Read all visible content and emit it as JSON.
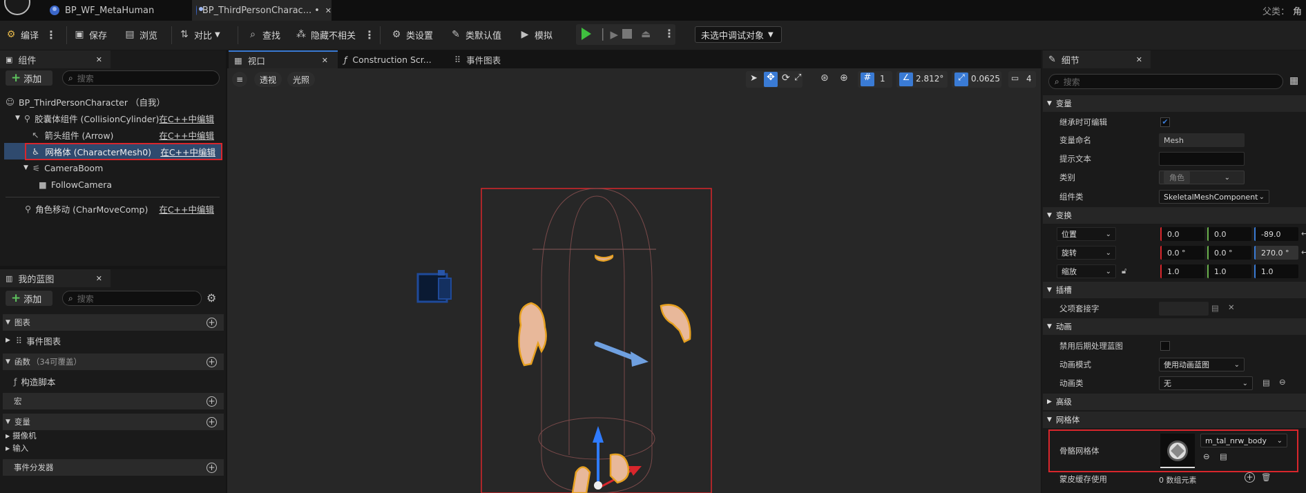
{
  "titlebar": {
    "tabs": [
      {
        "label": "BP_WF_MetaHuman"
      },
      {
        "label": "BP_ThirdPersonCharac...",
        "modified": "•",
        "close": "✕"
      }
    ],
    "parent_label": "父类：",
    "parent_value": "角"
  },
  "toolbar": {
    "compile": "编译",
    "save": "保存",
    "browse": "浏览",
    "diff": "对比",
    "find": "查找",
    "hide_unrelated": "隐藏不相关",
    "class_settings": "类设置",
    "class_defaults": "类默认值",
    "simulate": "模拟",
    "debug_target": "未选中调试对象"
  },
  "components": {
    "title": "组件",
    "close": "✕",
    "add": "添加",
    "search_placeholder": "搜索",
    "root": "BP_ThirdPersonCharacter （自我）",
    "edit_in_cpp": "在C++中编辑",
    "items": [
      {
        "label": "胶囊体组件 (CollisionCylinder)",
        "cpp": "在C++中编辑"
      },
      {
        "label": "箭头组件 (Arrow)",
        "cpp": "在C++中编辑"
      },
      {
        "label": "网格体 (CharacterMesh0)",
        "cpp": "在C++中编辑",
        "selected": true
      },
      {
        "label": "CameraBoom"
      },
      {
        "label": "FollowCamera"
      },
      {
        "label": "角色移动 (CharMoveComp)",
        "cpp": "在C++中编辑"
      }
    ]
  },
  "myblueprint": {
    "title": "我的蓝图",
    "close": "✕",
    "add": "添加",
    "search_placeholder": "搜索",
    "graphs": "图表",
    "event_graph": "事件图表",
    "functions": "函数",
    "functions_note": "（34可覆盖）",
    "construction_script": "构造脚本",
    "macros": "宏",
    "variables": "变量",
    "var_camera": "摄像机",
    "var_input": "输入",
    "event_dispatchers": "事件分发器"
  },
  "viewport": {
    "tabs": [
      {
        "label": "视口",
        "close": "✕"
      },
      {
        "label": "Construction Scr..."
      },
      {
        "label": "事件图表"
      }
    ],
    "perspective": "透视",
    "lit": "光照",
    "grid_value": "1",
    "rotation_snap": "2.812°",
    "scale_snap": "0.0625",
    "camera_speed": "4"
  },
  "details": {
    "title": "细节",
    "close": "✕",
    "search_placeholder": "搜索",
    "sections": {
      "variable": "变量",
      "transform": "变换",
      "sockets": "插槽",
      "animation": "动画",
      "advanced": "高级",
      "mesh": "网格体"
    },
    "props": {
      "editable_when_inherited": "继承时可编辑",
      "variable_name": "变量命名",
      "variable_name_value": "Mesh",
      "tooltip": "提示文本",
      "category": "类别",
      "category_value": "角色",
      "component_class": "组件类",
      "component_class_value": "SkeletalMeshComponent",
      "location": "位置",
      "location_values": [
        "0.0",
        "0.0",
        "-89.0"
      ],
      "rotation": "旋转",
      "rotation_values": [
        "0.0 °",
        "0.0 °",
        "270.0 °"
      ],
      "scale": "缩放",
      "scale_values": [
        "1.0",
        "1.0",
        "1.0"
      ],
      "parent_socket": "父项套接字",
      "disable_post_process": "禁用后期处理蓝图",
      "anim_mode": "动画模式",
      "anim_mode_value": "使用动画蓝图",
      "anim_class": "动画类",
      "anim_class_value": "无",
      "skeletal_mesh": "骨骼网格体",
      "skeletal_mesh_value": "m_tal_nrw_body",
      "skin_cache": "蒙皮缓存使用",
      "skin_cache_value": "0 数组元素"
    }
  },
  "colors": {
    "accent": "#3a7bd5",
    "highlight": "#d9262c",
    "selected_row": "#2f4a6e"
  }
}
